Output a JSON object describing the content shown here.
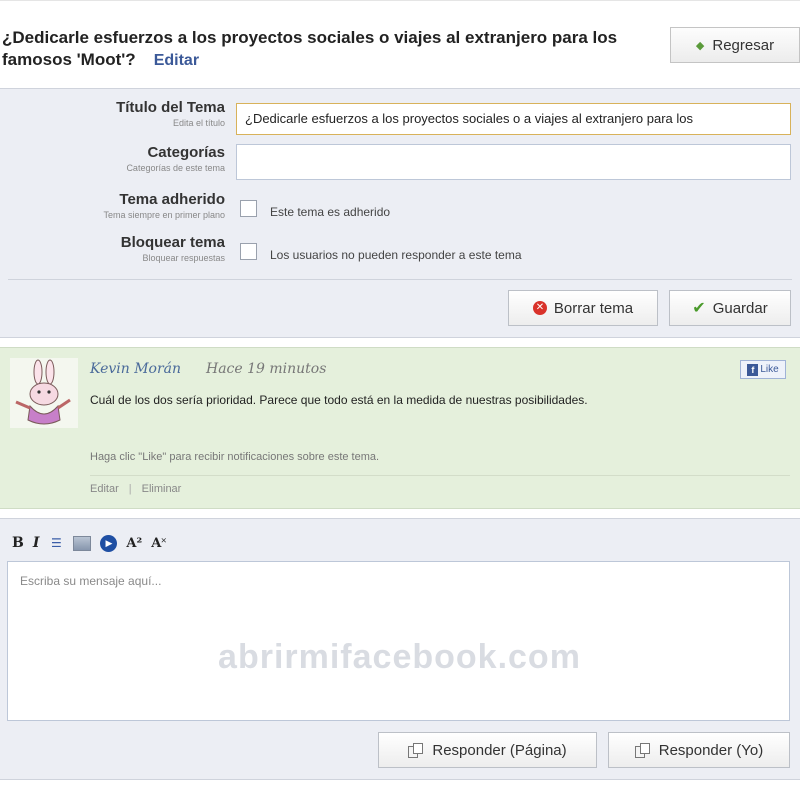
{
  "header": {
    "topic_title": "¿Dedicarle esfuerzos a los proyectos sociales o viajes al extranjero para los famosos 'Moot'?",
    "edit_label": "Editar",
    "back_label": "Regresar"
  },
  "form": {
    "title": {
      "label": "Título del Tema",
      "sublabel": "Edita el título",
      "value": "¿Dedicarle esfuerzos a los proyectos sociales o a viajes al extranjero para los"
    },
    "categories": {
      "label": "Categorías",
      "sublabel": "Categorías de este tema",
      "value": ""
    },
    "sticky": {
      "label": "Tema adherido",
      "sublabel": "Tema siempre en primer plano",
      "checkbox_label": "Este tema es adherido",
      "checked": false
    },
    "lock": {
      "label": "Bloquear tema",
      "sublabel": "Bloquear respuestas",
      "checkbox_label": "Los usuarios no pueden responder a este tema",
      "checked": false
    },
    "delete_label": "Borrar tema",
    "save_label": "Guardar"
  },
  "post": {
    "author": "Kevin Morán",
    "time": "Hace 19 minutos",
    "like_label": "Like",
    "body": "Cuál de los dos sería prioridad. Parece que todo está en la medida de nuestras posibilidades.",
    "notify": "Haga clic \"Like\" para recibir notificaciones sobre este tema.",
    "edit_label": "Editar",
    "delete_label": "Eliminar"
  },
  "reply": {
    "toolbar": {
      "bold": "B",
      "italic": "I",
      "list": "☰",
      "video": "▶",
      "superscript": "A²",
      "subscript": "A˟"
    },
    "placeholder": "Escriba su mensaje aquí...",
    "watermark": "abrirmifacebook.com",
    "reply_page_label": "Responder (Página)",
    "reply_me_label": "Responder (Yo)"
  },
  "colors": {
    "link": "#3b5998",
    "post_bg": "#e5f0dc",
    "panel_bg": "#eceef4",
    "delete_red": "#d9322a",
    "check_green": "#4a9a2b"
  },
  "icons": [
    "back-arrow-icon",
    "delete-icon",
    "check-icon",
    "facebook-like-icon",
    "reply-icon"
  ]
}
